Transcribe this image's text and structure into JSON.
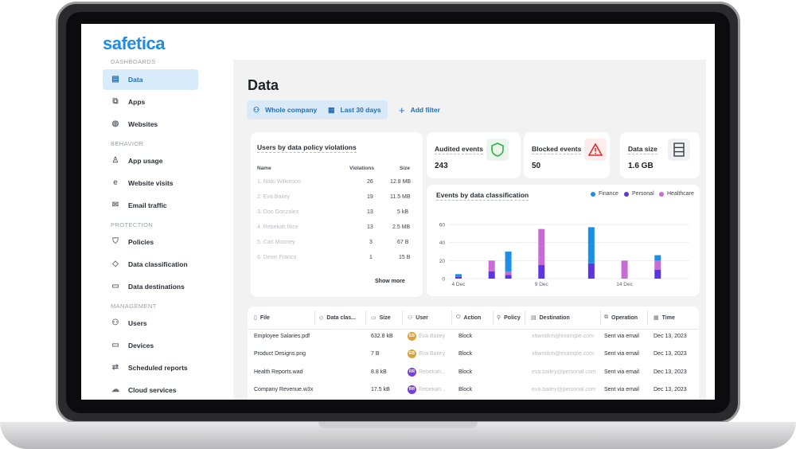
{
  "brand": {
    "name": "safetica"
  },
  "sidebar": {
    "sections": [
      {
        "label": "DASHBOARDS"
      },
      {
        "label": "BEHAVIOR"
      },
      {
        "label": "PROTECTION"
      },
      {
        "label": "MANAGEMENT"
      }
    ],
    "items": [
      {
        "label": "Data",
        "icon": "document-icon"
      },
      {
        "label": "Apps",
        "icon": "apps-icon"
      },
      {
        "label": "Websites",
        "icon": "globe-icon"
      },
      {
        "label": "App usage",
        "icon": "chess-icon"
      },
      {
        "label": "Website visits",
        "icon": "browser-icon"
      },
      {
        "label": "Email traffic",
        "icon": "mail-icon"
      },
      {
        "label": "Policies",
        "icon": "shield-icon"
      },
      {
        "label": "Data classification",
        "icon": "tag-icon"
      },
      {
        "label": "Data destinations",
        "icon": "briefcase-icon"
      },
      {
        "label": "Users",
        "icon": "users-icon"
      },
      {
        "label": "Devices",
        "icon": "devices-icon"
      },
      {
        "label": "Scheduled reports",
        "icon": "report-icon"
      },
      {
        "label": "Cloud services",
        "icon": "cloud-icon"
      }
    ]
  },
  "page": {
    "title": "Data",
    "filters": {
      "scope": "Whole company",
      "period": "Last 30 days",
      "add": "Add filter"
    }
  },
  "violations": {
    "title": "Users by data policy violations",
    "headers": {
      "name": "Name",
      "violations": "Violations",
      "size": "Size"
    },
    "rows": [
      {
        "name": "1. Nikki Wilkinson",
        "violations": "26",
        "size": "12.8 MB"
      },
      {
        "name": "2. Eva Bailey",
        "violations": "19",
        "size": "11.5 MB"
      },
      {
        "name": "3. Don Gonzalez",
        "violations": "13",
        "size": "5 kB"
      },
      {
        "name": "4. Rebekah Rice",
        "violations": "13",
        "size": "2.5 MB"
      },
      {
        "name": "5. Carl Mooney",
        "violations": "3",
        "size": "67 B"
      },
      {
        "name": "6. Devin Franco",
        "violations": "1",
        "size": "15 B"
      }
    ],
    "show_more": "Show more"
  },
  "stats": {
    "audited": {
      "label": "Audited events",
      "value": "243"
    },
    "blocked": {
      "label": "Blocked events",
      "value": "50"
    },
    "size": {
      "label": "Data size",
      "value": "1.6 GB"
    }
  },
  "colors": {
    "finance": "#1e8fe6",
    "personal": "#5b35e0",
    "healthcare": "#c86bd6",
    "accent": "#1f6fb8"
  },
  "chart_data": {
    "type": "bar",
    "title": "Events by data classification",
    "stacked": true,
    "ylim": [
      0,
      60
    ],
    "yticks": [
      0,
      20,
      40,
      60
    ],
    "xtick_labels": [
      "4 Dec",
      "9 Dec",
      "14 Dec"
    ],
    "legend_position": "top-right",
    "grid": true,
    "series": [
      {
        "name": "Finance",
        "values": [
          3,
          0,
          0,
          22,
          0,
          0,
          0,
          0,
          40,
          0,
          0,
          0,
          6,
          0
        ]
      },
      {
        "name": "Personal",
        "values": [
          2,
          0,
          8,
          4,
          0,
          15,
          0,
          0,
          17,
          0,
          0,
          0,
          10,
          0
        ]
      },
      {
        "name": "Healthcare",
        "values": [
          0,
          0,
          12,
          4,
          0,
          40,
          0,
          0,
          0,
          0,
          20,
          0,
          10,
          0
        ]
      }
    ]
  },
  "events_table": {
    "headers": [
      "File",
      "Data clas...",
      "Size",
      "User",
      "Action",
      "Policy",
      "Destination",
      "Operation",
      "Time"
    ],
    "rows": [
      {
        "file": "Employee Salaries.pdf",
        "size": "632.8 kB",
        "initials": "EB",
        "user": "Eva Bailey",
        "action": "Block",
        "destination": "xhwmlkm@example.com",
        "operation": "Sent via email",
        "time": "Dec 13, 2023"
      },
      {
        "file": "Product Designs.png",
        "size": "7 B",
        "initials": "EB",
        "user": "Eva Bailey",
        "action": "Block",
        "destination": "xhwmlkm@example.com",
        "operation": "Sent via email",
        "time": "Dec 13, 2023"
      },
      {
        "file": "Health Reports.wad",
        "size": "8.8 kB",
        "initials": "RR",
        "user": "Rebekah...",
        "action": "Block",
        "destination": "eva.bailey@personal.com",
        "operation": "Sent via email",
        "time": "Dec 13, 2023"
      },
      {
        "file": "Company Revenue.w3x",
        "size": "17.5 kB",
        "initials": "RR",
        "user": "Rebekah...",
        "action": "Block",
        "destination": "eva.bailey@personal.com",
        "operation": "Sent via email",
        "time": "Dec 13, 2023"
      }
    ]
  }
}
